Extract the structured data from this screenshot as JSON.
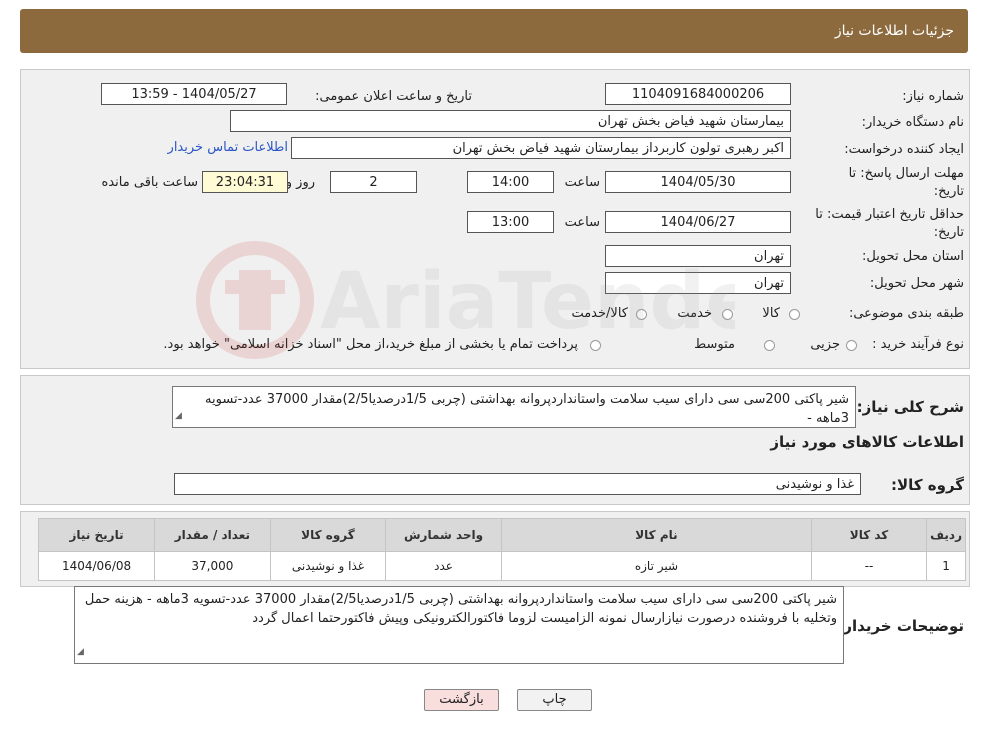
{
  "header": {
    "title": "جزئیات اطلاعات نیاز"
  },
  "info": {
    "need_number_label": "شماره نیاز:",
    "need_number": "1104091684000206",
    "announce_label": "تاریخ و ساعت اعلان عمومی:",
    "announce_value": "1404/05/27 - 13:59",
    "buyer_label": "نام دستگاه خریدار:",
    "buyer_value": "بیمارستان شهید فیاض بخش تهران",
    "creator_label": "ایجاد کننده درخواست:",
    "creator_value": "اکبر رهبری تولون کاربرداز بیمارستان شهید فیاض بخش تهران",
    "contact_link": "اطلاعات تماس خریدار",
    "deadline_label_1": "مهلت ارسال پاسخ: تا",
    "deadline_label_2": "تاریخ:",
    "deadline_date": "1404/05/30",
    "time_label": "ساعت",
    "deadline_time": "14:00",
    "deadline_days": "2",
    "days_label": "روز و",
    "remaining_time": "23:04:31",
    "remaining_label": "ساعت باقی مانده",
    "validity_label_1": "حداقل تاریخ اعتبار قیمت: تا",
    "validity_label_2": "تاریخ:",
    "validity_date": "1404/06/27",
    "validity_time": "13:00",
    "province_label": "استان محل تحویل:",
    "province_value": "تهران",
    "city_label": "شهر محل تحویل:",
    "city_value": "تهران",
    "category_label": "طبقه بندی موضوعی:",
    "category_options": [
      "کالا",
      "خدمت",
      "کالا/خدمت"
    ],
    "process_label": "نوع فرآیند خرید :",
    "process_options": [
      "جزیی",
      "متوسط"
    ],
    "process_note": "پرداخت تمام یا بخشی از مبلغ خرید،از محل \"اسناد خزانه اسلامی\" خواهد بود."
  },
  "summary": {
    "label": "شرح کلی نیاز:",
    "text": "شیر پاکتی 200سی سی دارای سیب سلامت واستانداردپروانه بهداشتی (چربی 1/5درصدیا2/5)مقدار  37000 عدد-تسویه 3ماهه -",
    "goods_info_title": "اطلاعات کالاهای مورد نیاز",
    "group_label": "گروه کالا:",
    "group_value": "غذا و نوشیدنی"
  },
  "table": {
    "headers": [
      "ردیف",
      "کد کالا",
      "نام کالا",
      "واحد شمارش",
      "گروه کالا",
      "تعداد / مقدار",
      "تاریخ نیاز"
    ],
    "rows": [
      [
        "1",
        "--",
        "شیر تازه",
        "عدد",
        "غذا و نوشیدنی",
        "37,000",
        "1404/06/08"
      ]
    ]
  },
  "buyer_notes": {
    "label": "توضیحات خریدار:",
    "text": "شیر پاکتی 200سی سی دارای سیب سلامت واستانداردپروانه بهداشتی (چربی 1/5درصدیا2/5)مقدار  37000 عدد-تسویه 3ماهه - هزینه حمل وتخلیه با فروشنده درصورت نیازارسال نمونه الزامیست لزوما  فاکتورالکترونیکی وپیش فاکتورحتما اعمال گردد"
  },
  "buttons": {
    "print": "چاپ",
    "back": "بازگشت"
  },
  "watermark": {
    "text": "AriaTender.neT"
  },
  "colors": {
    "title_bar": "#8c6a3e",
    "link": "#2a56c6",
    "back_button": "#f9dede",
    "remaining_bg": "#fffbd5"
  }
}
